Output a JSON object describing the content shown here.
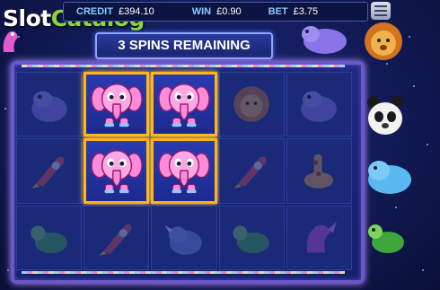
{
  "logo": {
    "part1": "Slot",
    "part2": "Catalog"
  },
  "topbar": {
    "credit_label": "CREDIT",
    "credit_value": "£394.10",
    "win_label": "WIN",
    "win_value": "£0.90",
    "bet_label": "BET",
    "bet_value": "£3.75"
  },
  "banner": {
    "text": "3 SPINS REMAINING"
  },
  "reels": {
    "rows": [
      [
        "hippo",
        "elephant",
        "elephant",
        "lion",
        "hippo"
      ],
      [
        "rocket",
        "elephant",
        "elephant",
        "rocket",
        "giraffe"
      ],
      [
        "turtle",
        "rocket",
        "rhino",
        "turtle",
        "dragon"
      ]
    ],
    "winning": [
      [
        0,
        1
      ],
      [
        0,
        2
      ],
      [
        1,
        1
      ],
      [
        1,
        2
      ]
    ]
  },
  "side_characters": [
    "dragon-icon",
    "hippo-icon",
    "lion-icon",
    "panda-icon",
    "hippo-icon",
    "turtle-icon"
  ],
  "colors": {
    "accent": "#ffb51a",
    "frame": "#6a58c8",
    "elephant": "#ff8ad8"
  }
}
